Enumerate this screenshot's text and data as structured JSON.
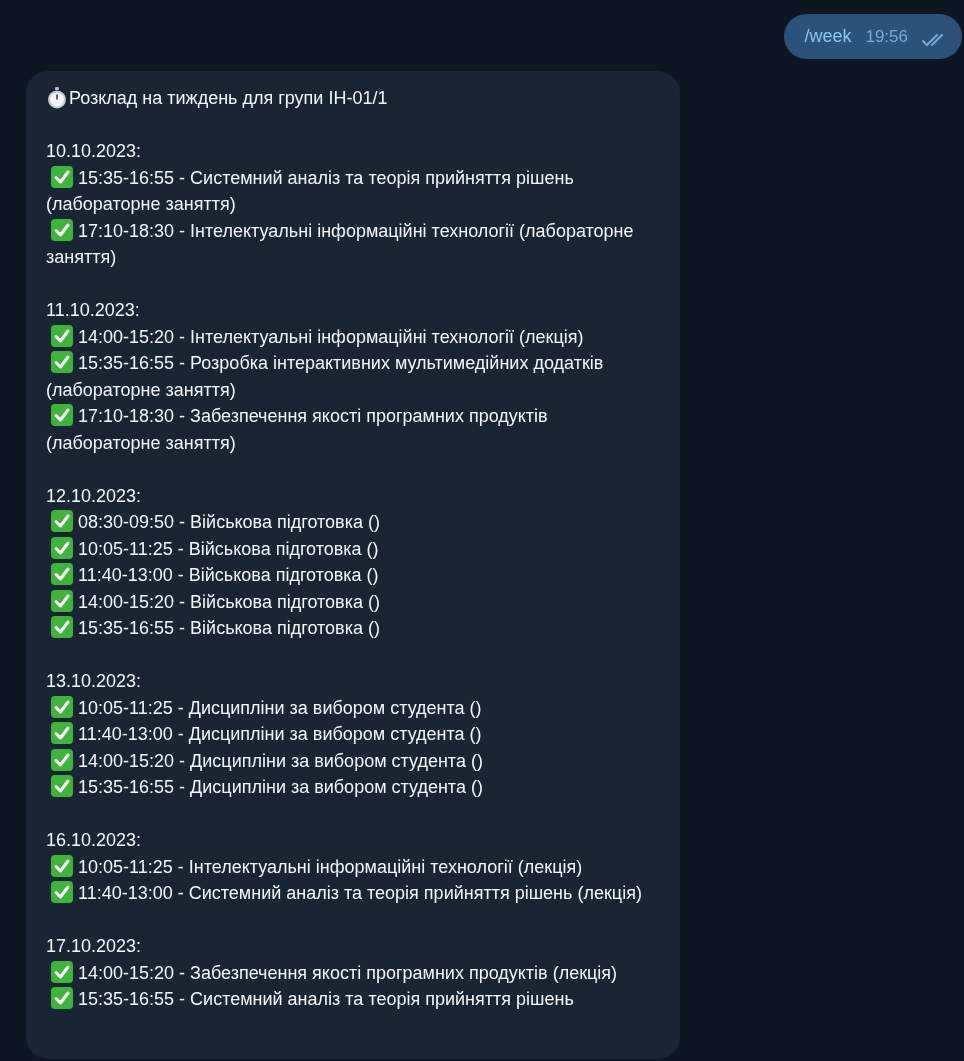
{
  "outgoing": {
    "text": "/week",
    "time": "19:56",
    "read": true
  },
  "incoming": {
    "title": "Розклад на тиждень для групи ІН-01/1",
    "days": [
      {
        "date": "10.10.2023:",
        "lessons": [
          {
            "text": "15:35-16:55 - Системний аналіз та теорія прийняття рішень (лабораторне заняття)",
            "checked": true
          },
          {
            "text": "17:10-18:30 - Інтелектуальні інформаційні технології (лабораторне заняття)",
            "checked": true
          }
        ]
      },
      {
        "date": "11.10.2023:",
        "lessons": [
          {
            "text": "14:00-15:20 - Інтелектуальні інформаційні технології (лекція)",
            "checked": true
          },
          {
            "text": "15:35-16:55 - Розробка інтерактивних мультимедійних додатків (лабораторне заняття)",
            "checked": true
          },
          {
            "text": "17:10-18:30 - Забезпечення якості програмних продуктів (лабораторне заняття)",
            "checked": true
          }
        ]
      },
      {
        "date": "12.10.2023:",
        "lessons": [
          {
            "text": "08:30-09:50 - Військова підготовка ()",
            "checked": true
          },
          {
            "text": "10:05-11:25 - Військова підготовка ()",
            "checked": true
          },
          {
            "text": "11:40-13:00 - Військова підготовка ()",
            "checked": true
          },
          {
            "text": "14:00-15:20 - Військова підготовка ()",
            "checked": true
          },
          {
            "text": "15:35-16:55 - Військова підготовка ()",
            "checked": true
          }
        ]
      },
      {
        "date": "13.10.2023:",
        "lessons": [
          {
            "text": "10:05-11:25 - Дисципліни за вибором студента ()",
            "checked": true
          },
          {
            "text": "11:40-13:00 - Дисципліни за вибором студента ()",
            "checked": true
          },
          {
            "text": "14:00-15:20 - Дисципліни за вибором студента ()",
            "checked": true
          },
          {
            "text": "15:35-16:55 - Дисципліни за вибором студента ()",
            "checked": true
          }
        ]
      },
      {
        "date": "16.10.2023:",
        "lessons": [
          {
            "text": "10:05-11:25 - Інтелектуальні інформаційні технології (лекція)",
            "checked": true
          },
          {
            "text": "11:40-13:00 - Системний аналіз та теорія прийняття рішень (лекція)",
            "checked": true
          }
        ]
      },
      {
        "date": "17.10.2023:",
        "lessons": [
          {
            "text": "14:00-15:20 - Забезпечення якості програмних продуктів (лекція)",
            "checked": true
          },
          {
            "text": "15:35-16:55 - Системний аналіз та теорія прийняття рішень",
            "checked": true
          }
        ]
      }
    ]
  }
}
